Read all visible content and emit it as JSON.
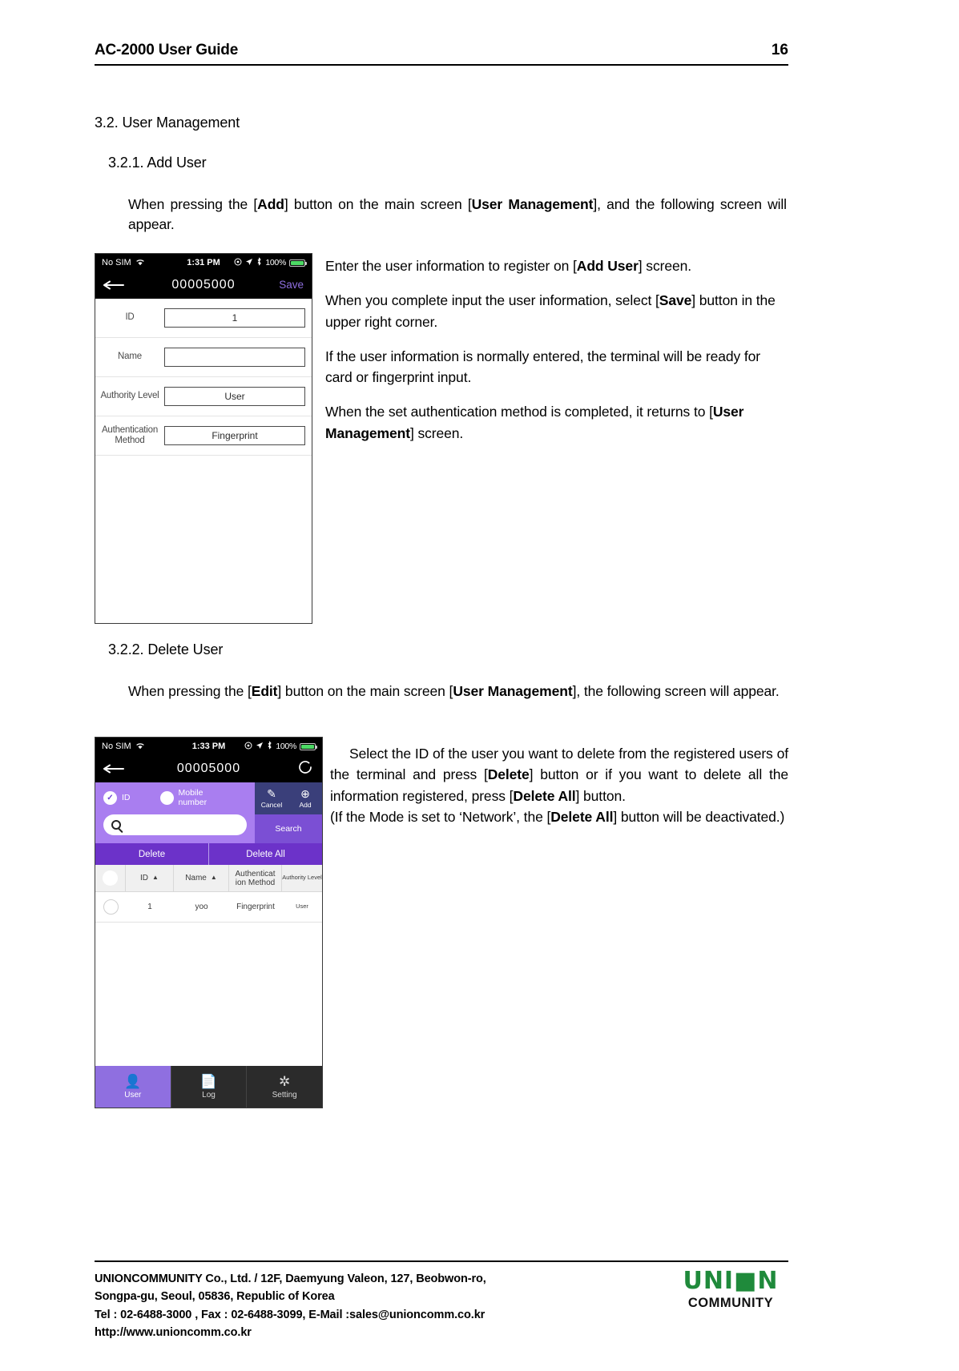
{
  "header": {
    "title": "AC-2000 User Guide",
    "page_number": "16"
  },
  "sections": {
    "h2": "3.2. User Management",
    "h3_add": "3.2.1. Add User",
    "h3_delete": "3.2.2. Delete User"
  },
  "intro_add": {
    "part1": "When pressing the [",
    "bold1": "Add",
    "part2": "] button on the main screen [",
    "bold2": "User Management",
    "part3": "], and the following screen will appear."
  },
  "intro_delete": {
    "part1": "When pressing the [",
    "bold1": "Edit",
    "part2": "] button on the main screen [",
    "bold2": "User Management",
    "part3": "], the following screen will appear."
  },
  "add_user_notes": {
    "p1_a": "Enter the user information to register on [",
    "p1_b": "Add User",
    "p1_c": "] screen.",
    "p2_a": "When you complete input the user information, select [",
    "p2_b": "Save",
    "p2_c": "] button in the upper right corner.",
    "p3": "If the user information is normally entered, the terminal will be ready for card or fingerprint input.",
    "p4_a": "When the set authentication method is completed, it returns to [",
    "p4_b": "User Management",
    "p4_c": "] screen."
  },
  "delete_user_notes": {
    "p1_a": "Select the ID of the user you want to delete from the registered users of the terminal and press [",
    "p1_b": "Delete",
    "p1_c": "] button or if you want to delete all the information registered, press [",
    "p1_d": "Delete All",
    "p1_e": "] button.",
    "p2_a": "(If the Mode is set to ‘Network’, the [",
    "p2_b": "Delete All",
    "p2_c": "] button will be deactivated.)"
  },
  "phone_add": {
    "status": {
      "carrier": "No SIM",
      "wifi_icon": "wifi-icon",
      "time": "1:31 PM",
      "alarm_icon": "alarm-icon",
      "location_icon": "location-arrow-icon",
      "bluetooth_icon": "bluetooth-icon",
      "battery_percent": "100%"
    },
    "navbar": {
      "back_icon": "back-arrow-icon",
      "title": "00005000",
      "save_label": "Save"
    },
    "fields": [
      {
        "label": "ID",
        "value": "1"
      },
      {
        "label": "Name",
        "value": ""
      },
      {
        "label": "Authority Level",
        "value": "User"
      },
      {
        "label": "Authentication\nMethod",
        "value": "Fingerprint"
      }
    ]
  },
  "phone_delete": {
    "status": {
      "carrier": "No SIM",
      "time": "1:33 PM",
      "battery_percent": "100%"
    },
    "navbar": {
      "back_icon": "back-arrow-icon",
      "title": "00005000",
      "refresh_icon": "refresh-icon"
    },
    "filter": {
      "option_id": "ID",
      "option_mobile": "Mobile number",
      "search_placeholder": ""
    },
    "actions": {
      "cancel_label": "Cancel",
      "add_label": "Add",
      "search_label": "Search",
      "delete_label": "Delete",
      "delete_all_label": "Delete All"
    },
    "table": {
      "columns": [
        "",
        "ID",
        "Name",
        "Authenticat ion Method",
        "Authority Level"
      ],
      "rows": [
        {
          "check": "",
          "id": "1",
          "name": "yoo",
          "auth": "Fingerprint",
          "level": "User"
        }
      ]
    },
    "tabs": [
      {
        "label": "User",
        "icon": "person-icon",
        "active": true
      },
      {
        "label": "Log",
        "icon": "document-icon",
        "active": false
      },
      {
        "label": "Setting",
        "icon": "gear-icon",
        "active": false
      }
    ]
  },
  "footer": {
    "line1": "UNIONCOMMUNITY Co., Ltd. / 12F, Daemyung Valeon, 127, Beobwon-ro,",
    "line2": "Songpa-gu, Seoul, 05836, Republic of Korea",
    "line3": "Tel : 02-6488-3000 , Fax : 02-6488-3099, E-Mail :sales@unioncomm.co.kr",
    "line4": "http://www.unioncomm.co.kr",
    "logo_mark": "UNI■N",
    "logo_word": "COMMUNITY"
  },
  "colors": {
    "accent_purple": "#8f6fe0",
    "deep_purple": "#6c32c9",
    "light_purple": "#a97ef0",
    "navy": "#3a3f7a",
    "logo_green": "#1f8a3b"
  }
}
